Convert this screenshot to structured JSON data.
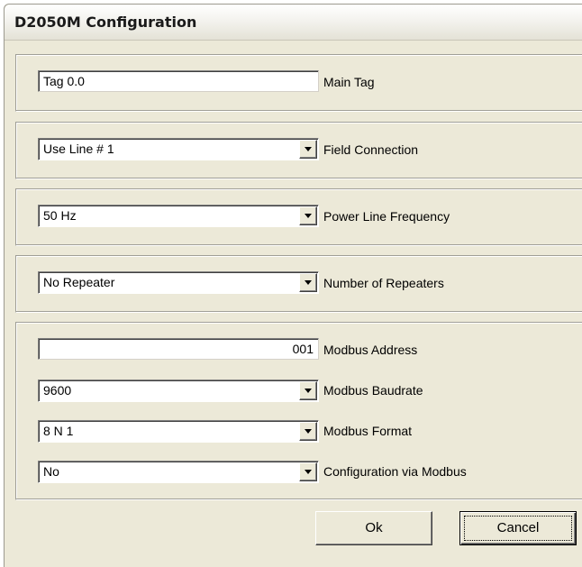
{
  "window": {
    "title": "D2050M Configuration"
  },
  "main_tag": {
    "value": "Tag 0.0",
    "label": "Main Tag"
  },
  "field_connection": {
    "value": "Use Line # 1",
    "label": "Field Connection"
  },
  "power_line_frequency": {
    "value": "50 Hz",
    "label": "Power Line Frequency"
  },
  "repeaters": {
    "value": "No Repeater",
    "label": "Number of Repeaters"
  },
  "modbus": {
    "address": {
      "value": "001",
      "label": "Modbus Address"
    },
    "baudrate": {
      "value": "9600",
      "label": "Modbus Baudrate"
    },
    "format": {
      "value": "8 N 1",
      "label": "Modbus Format"
    },
    "config_via": {
      "value": "No",
      "label": "Configuration via Modbus"
    }
  },
  "buttons": {
    "ok": "Ok",
    "cancel": "Cancel"
  },
  "icons": {
    "dropdown": "chevron-down-icon"
  }
}
